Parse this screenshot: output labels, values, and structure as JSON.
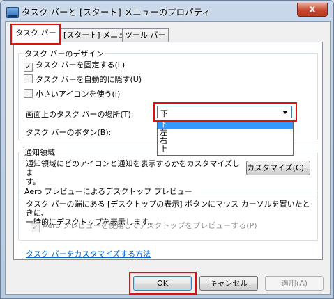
{
  "window": {
    "title": "タスク バーと [スタート] メニューのプロパティ",
    "close_glyph": "x"
  },
  "tabs": [
    {
      "label": "タスク バー"
    },
    {
      "label": "[スタート] メニュー"
    },
    {
      "label": "ツール バー"
    }
  ],
  "appearance": {
    "title": "タスク バーのデザイン",
    "lock": {
      "label": "タスク バーを固定する(L)",
      "checked": true,
      "mark": "✓"
    },
    "autohide": {
      "label": "タスク バーを自動的に隠す(U)",
      "checked": false
    },
    "small_icons": {
      "label": "小さいアイコンを使う(I)",
      "checked": false
    },
    "location_label": "画面上のタスク バーの場所(T):",
    "location_value": "下",
    "location_options": [
      "下",
      "左",
      "右",
      "上"
    ],
    "buttons_label": "タスク バーのボタン(B):"
  },
  "notification": {
    "title": "通知領域",
    "text_line1": "通知領域にどのアイコンと通知を表示するかをカスタマイズしま",
    "text_line2": "す。",
    "customize_button": "カスタマイズ(C)..."
  },
  "aero": {
    "title": "Aero プレビューによるデスクトップ プレビュー",
    "text_line1": "タスク バーの端にある [デスクトップの表示] ボタンにマウス カーソルを置いたときに、",
    "text_line2": "一時的にデスクトップを表示します。",
    "checkbox": {
      "label": "Aero プレビューを使用してデスクトップをプレビューする(P)",
      "checked": true,
      "mark": "✓"
    }
  },
  "help_link": "タスク バーをカスタマイズする方法",
  "footer": {
    "ok": "OK",
    "cancel": "キャンセル",
    "apply": "適用(A)"
  }
}
